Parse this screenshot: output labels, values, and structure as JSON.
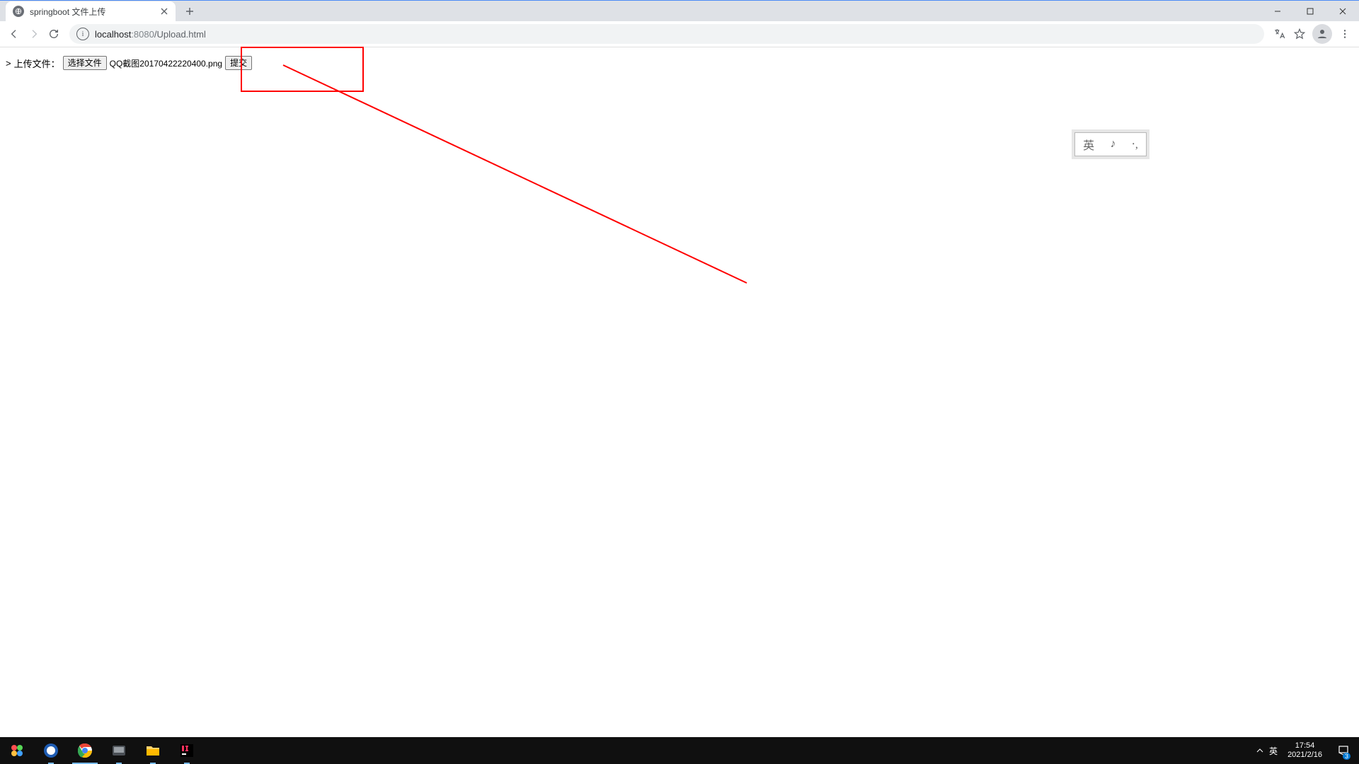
{
  "browser": {
    "tab_title": "springboot 文件上传",
    "url_host": "localhost",
    "url_port": ":8080",
    "url_path": "/Upload.html"
  },
  "page": {
    "bullet": ">",
    "label": "上传文件：",
    "choose_btn": "选择文件",
    "filename": "QQ截图20170422220400.png",
    "submit_btn": "提交"
  },
  "ime": {
    "char1": "英",
    "char2": "♪",
    "char3": "‧,"
  },
  "taskbar": {
    "lang": "英",
    "time": "17:54",
    "date": "2021/2/16",
    "notif_count": "3"
  }
}
